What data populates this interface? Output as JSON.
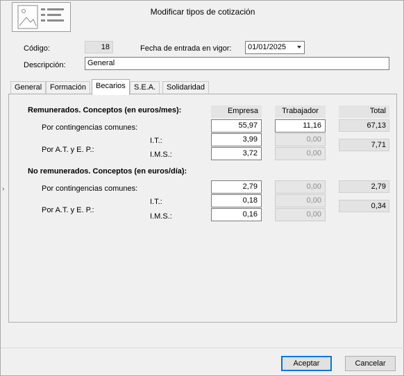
{
  "dialog": {
    "title": "Modificar tipos de cotización"
  },
  "form": {
    "codigo_label": "Código:",
    "codigo_value": "18",
    "fecha_label": "Fecha de entrada en vigor:",
    "fecha_value": "01/01/2025",
    "descripcion_label": "Descripción:",
    "descripcion_value": "General"
  },
  "tabs": [
    {
      "label": "General",
      "active": false
    },
    {
      "label": "Formación",
      "active": false
    },
    {
      "label": "Becarios",
      "active": true
    },
    {
      "label": "S.E.A.",
      "active": false
    },
    {
      "label": "Solidaridad",
      "active": false
    }
  ],
  "columns": {
    "empresa": "Empresa",
    "trabajador": "Trabajador",
    "total": "Total"
  },
  "remunerados": {
    "heading": "Remunerados. Conceptos (en euros/mes):",
    "contingencias_label": "Por contingencias comunes:",
    "contingencias": {
      "empresa": "55,97",
      "trabajador": "11,16",
      "total": "67,13"
    },
    "at_label": "Por A.T. y E. P.:",
    "it_label": "I.T.:",
    "ims_label": "I.M.S.:",
    "it": {
      "empresa": "3,99",
      "trabajador": "0,00"
    },
    "ims": {
      "empresa": "3,72",
      "trabajador": "0,00"
    },
    "at_total": "7,71"
  },
  "no_remunerados": {
    "heading": "No remunerados. Conceptos (en euros/día):",
    "contingencias_label": "Por contingencias comunes:",
    "contingencias": {
      "empresa": "2,79",
      "trabajador": "0,00",
      "total": "2,79"
    },
    "at_label": "Por A.T. y E. P.:",
    "it_label": "I.T.:",
    "ims_label": "I.M.S.:",
    "it": {
      "empresa": "0,18",
      "trabajador": "0,00"
    },
    "ims": {
      "empresa": "0,16",
      "trabajador": "0,00"
    },
    "at_total": "0,34"
  },
  "buttons": {
    "accept": "Aceptar",
    "cancel": "Cancelar"
  },
  "colors": {
    "accent": "#0078d7",
    "window_bg": "#f0f0f0"
  },
  "icons": {
    "header": "image-placeholder-icon",
    "dropdown": "chevron-down-icon",
    "side": "chevron-right-icon"
  }
}
